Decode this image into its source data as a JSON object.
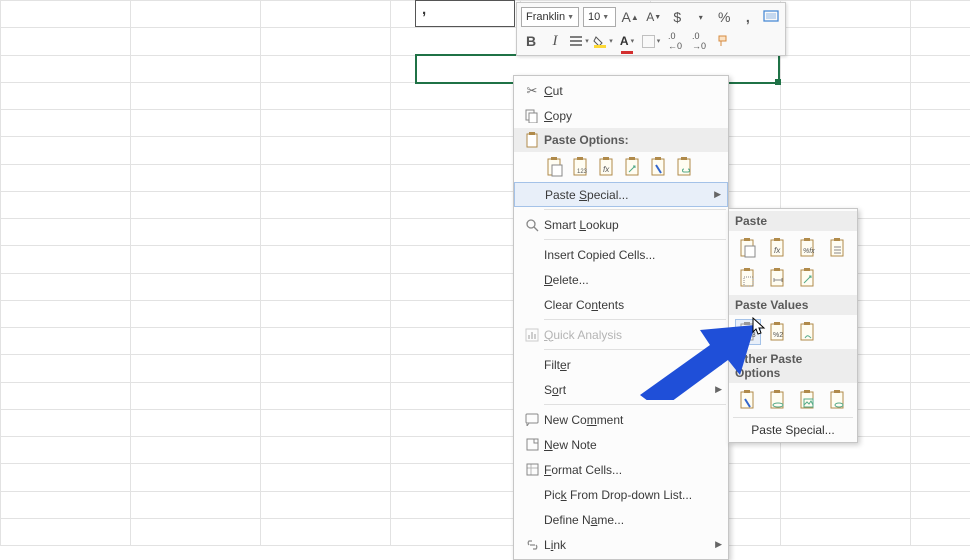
{
  "cell_entry": ",",
  "mini_toolbar": {
    "font_name": "Franklin",
    "font_size": "10",
    "increase_font": "A▲",
    "decrease_font": "A▼",
    "currency": "$",
    "percent": "%",
    "comma": ",",
    "bold": "B",
    "italic": "I"
  },
  "context_menu": {
    "cut": "Cut",
    "copy": "Copy",
    "paste_options_header": "Paste Options:",
    "paste_special": "Paste Special...",
    "smart_lookup": "Smart Lookup",
    "insert_copied": "Insert Copied Cells...",
    "delete": "Delete...",
    "clear_contents": "Clear Contents",
    "quick_analysis": "Quick Analysis",
    "filter": "Filter",
    "sort": "Sort",
    "new_comment": "New Comment",
    "new_note": "New Note",
    "format_cells": "Format Cells...",
    "pick_from_list": "Pick From Drop-down List...",
    "define_name": "Define Name...",
    "link": "Link",
    "paste_icons": [
      "paste",
      "paste-values-123",
      "paste-formulas",
      "paste-transpose",
      "paste-formatting",
      "paste-link"
    ]
  },
  "submenu": {
    "header_paste": "Paste",
    "header_values": "Paste Values",
    "header_other": "Other Paste Options",
    "footer": "Paste Special...",
    "row1": [
      "paste",
      "paste-formulas",
      "paste-fx",
      "paste-keep-source"
    ],
    "row2": [
      "paste-no-borders",
      "paste-col-width",
      "paste-transpose"
    ],
    "row_values": [
      "paste-values",
      "paste-values-format",
      "paste-values-source"
    ],
    "row_other": [
      "paste-formatting",
      "paste-link",
      "paste-picture",
      "paste-linked-picture"
    ]
  }
}
